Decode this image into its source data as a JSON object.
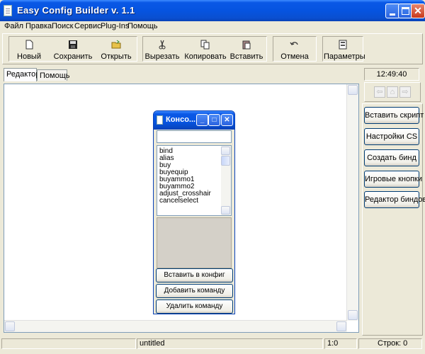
{
  "window": {
    "title": "Easy Config Builder v. 1.1"
  },
  "menu": [
    "Файл",
    "Правка",
    "Поиск",
    "Сервис",
    "Plug-Ins",
    "Помощь"
  ],
  "toolbar": {
    "new": "Новый",
    "save": "Сохранить",
    "open": "Открыть",
    "cut": "Вырезать",
    "copy": "Копировать",
    "paste": "Вставить",
    "undo": "Отмена",
    "settings": "Параметры"
  },
  "tabs": [
    "Редактор",
    "Помощь"
  ],
  "clock": "12:49:40",
  "nav": {
    "back": "⇦",
    "home": "⌂",
    "forward": "⇨"
  },
  "side_buttons": [
    "Вставить скрипт",
    "Настройки CS",
    "Создать бинд",
    "Игровые кнопки",
    "Редактор биндов"
  ],
  "console": {
    "title": "Консо...",
    "input_value": "",
    "commands": [
      "bind",
      "alias",
      "buy",
      "buyequip",
      "buyammo1",
      "buyammo2",
      "adjust_crosshair",
      "cancelselect"
    ],
    "buttons": [
      "Вставить в конфиг",
      "Добавить команду",
      "Удалить команду"
    ]
  },
  "status": {
    "file": "untitled",
    "position": "1:0",
    "lines": "Строк: 0"
  },
  "colors": {
    "titlebar": "#0a58e6",
    "window_bg": "#ece9d8",
    "close_button": "#c9391c"
  }
}
